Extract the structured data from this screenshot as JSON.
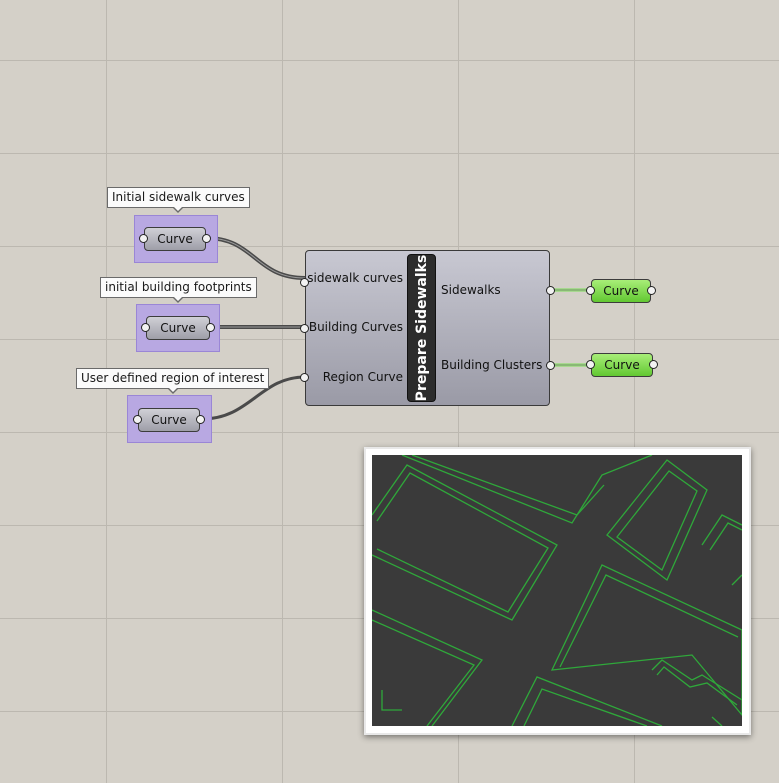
{
  "canvas": {
    "inputs": [
      {
        "note": "Initial sidewalk curves",
        "label": "Curve"
      },
      {
        "note": "initial building footprints",
        "label": "Curve"
      },
      {
        "note": "User defined region of interest",
        "label": "Curve"
      }
    ],
    "component": {
      "name": "Prepare Sidewalks",
      "inputs": [
        "sidewalk curves",
        "Building Curves",
        "Region Curve"
      ],
      "outputs": [
        "Sidewalks",
        "Building Clusters"
      ]
    },
    "outputs": [
      {
        "label": "Curve"
      },
      {
        "label": "Curve"
      }
    ]
  },
  "colors": {
    "canvas_bg": "#d4d0c8",
    "group_fill": "#b8a8e2",
    "output_param": "#7ad84a",
    "preview_bg": "#3a3a3a",
    "preview_lines": "#2fa83a"
  },
  "preview": {
    "type": "curve-preview",
    "stroke": "#2fa83a"
  }
}
